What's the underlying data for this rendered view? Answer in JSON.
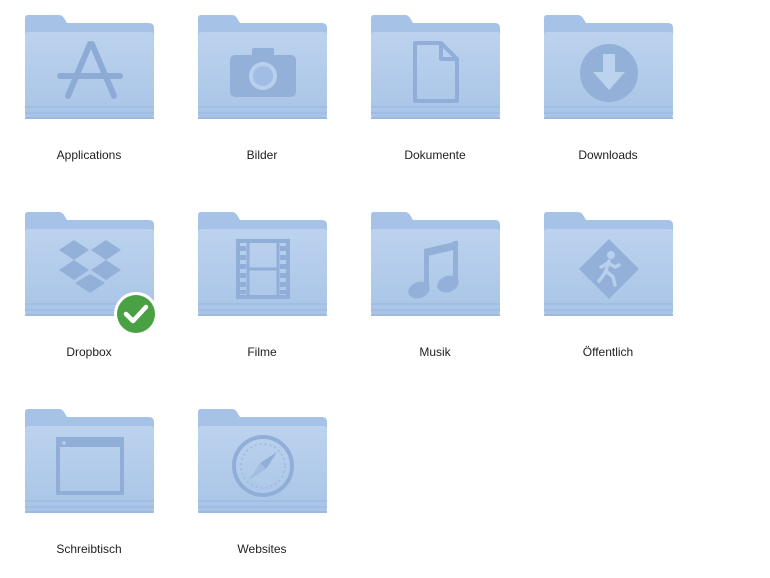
{
  "folders": [
    {
      "name": "Applications",
      "icon": "app-store-icon"
    },
    {
      "name": "Bilder",
      "icon": "camera-icon"
    },
    {
      "name": "Dokumente",
      "icon": "document-icon"
    },
    {
      "name": "Downloads",
      "icon": "download-arrow-icon"
    },
    {
      "name": "Dropbox",
      "icon": "dropbox-icon",
      "badge": "sync-complete-checkmark-icon"
    },
    {
      "name": "Filme",
      "icon": "film-strip-icon"
    },
    {
      "name": "Musik",
      "icon": "music-note-icon"
    },
    {
      "name": "Öffentlich",
      "icon": "public-walking-person-icon"
    },
    {
      "name": "Schreibtisch",
      "icon": "desktop-window-icon"
    },
    {
      "name": "Websites",
      "icon": "safari-compass-icon"
    }
  ],
  "colors": {
    "folder_back": "#a6c2e6",
    "folder_front": "#b5cfec",
    "folder_emboss": "#90afd8",
    "badge_green": "#4aa144"
  }
}
